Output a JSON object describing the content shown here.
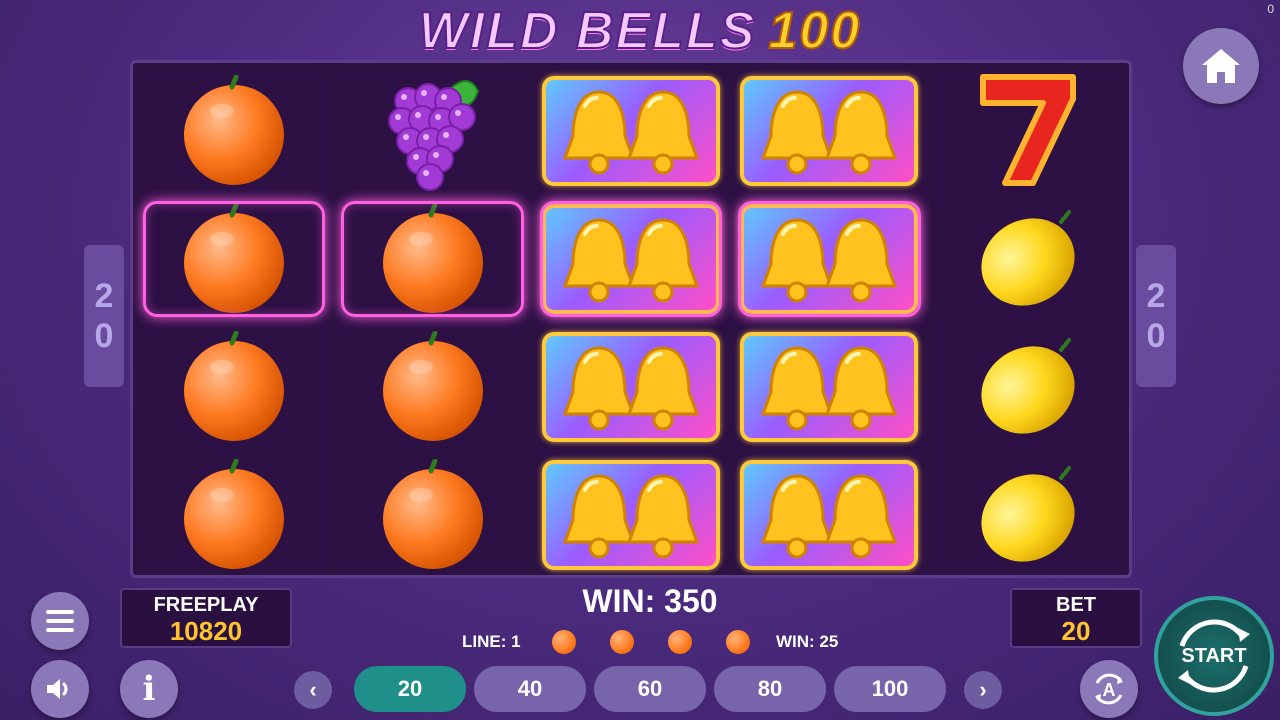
{
  "corner_counter": "0",
  "title": {
    "main": "WILD BELLS",
    "number": "100"
  },
  "lines_indicator": {
    "left": [
      "2",
      "0"
    ],
    "right": [
      "2",
      "0"
    ]
  },
  "reels": [
    [
      "orange",
      "orange",
      "orange",
      "orange"
    ],
    [
      "grapes",
      "orange",
      "orange",
      "orange"
    ],
    [
      "bells",
      "bells",
      "bells",
      "bells"
    ],
    [
      "bells",
      "bells",
      "bells",
      "bells"
    ],
    [
      "seven",
      "lemon",
      "lemon",
      "lemon"
    ]
  ],
  "highlighted_cells": [
    "0-1",
    "1-1",
    "2-1",
    "3-1"
  ],
  "freeplay": {
    "label": "FREEPLAY",
    "value": "10820"
  },
  "bet": {
    "label": "BET",
    "value": "20"
  },
  "win": {
    "total": "WIN: 350",
    "line_label": "LINE: 1",
    "line_win": "WIN: 25",
    "symbol_count": 4
  },
  "bet_options": [
    "20",
    "40",
    "60",
    "80",
    "100"
  ],
  "selected_bet": "20",
  "buttons": {
    "start": "START"
  },
  "icons": [
    "home-icon",
    "menu-icon",
    "sound-icon",
    "info-icon",
    "autoplay-icon",
    "chevron-left-icon",
    "chevron-right-icon",
    "start-spin-icon"
  ],
  "colors": {
    "accent": "#1f8f8a",
    "gold": "#ffc42e",
    "win_frame": "#ff5fe0",
    "background": "#4a2a7c"
  }
}
